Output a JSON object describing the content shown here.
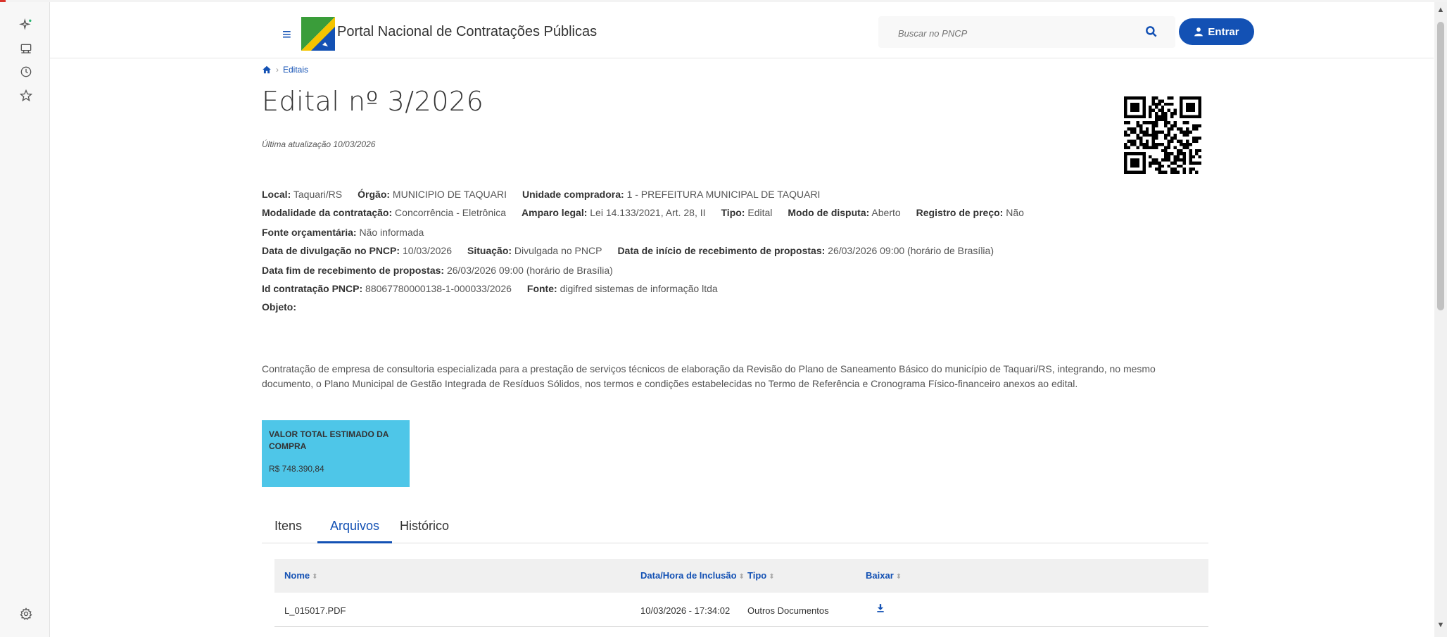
{
  "header": {
    "portal_title": "Portal Nacional de Contratações Públicas",
    "search_placeholder": "Buscar no PNCP",
    "login_label": "Entrar"
  },
  "breadcrumb": {
    "current": "Editais"
  },
  "edital": {
    "title": "Edital nº 3/2026",
    "updated": "Última atualização 10/03/2026",
    "rows": [
      [
        {
          "label": "Local:",
          "value": "Taquari/RS"
        },
        {
          "label": "Órgão:",
          "value": "MUNICIPIO DE TAQUARI"
        },
        {
          "label": "Unidade compradora:",
          "value": "1 - PREFEITURA MUNICIPAL DE TAQUARI"
        }
      ],
      [
        {
          "label": "Modalidade da contratação:",
          "value": "Concorrência - Eletrônica"
        },
        {
          "label": "Amparo legal:",
          "value": "Lei 14.133/2021, Art. 28, II"
        },
        {
          "label": "Tipo:",
          "value": "Edital"
        },
        {
          "label": "Modo de disputa:",
          "value": "Aberto"
        },
        {
          "label": "Registro de preço:",
          "value": "Não"
        }
      ],
      [
        {
          "label": "Fonte orçamentária:",
          "value": "Não informada"
        }
      ],
      [
        {
          "label": "Data de divulgação no PNCP:",
          "value": "10/03/2026"
        },
        {
          "label": "Situação:",
          "value": "Divulgada no PNCP"
        },
        {
          "label": "Data de início de recebimento de propostas:",
          "value": "26/03/2026 09:00 (horário de Brasília)"
        }
      ],
      [
        {
          "label": "Data fim de recebimento de propostas:",
          "value": "26/03/2026 09:00 (horário de Brasília)"
        }
      ],
      [
        {
          "label": "Id contratação PNCP:",
          "value": "88067780000138-1-000033/2026"
        },
        {
          "label": "Fonte:",
          "value": "digifred sistemas de informação ltda"
        }
      ],
      [
        {
          "label": "Objeto:",
          "value": ""
        }
      ]
    ],
    "objeto": "Contratação de empresa de consultoria especializada para a prestação de serviços técnicos de elaboração da Revisão do Plano de Saneamento Básico do município de Taquari/RS, integrando, no mesmo documento, o Plano Municipal de Gestão Integrada de Resíduos Sólidos, nos termos e condições estabelecidas no Termo de Referência e Cronograma Físico-financeiro anexos ao edital.",
    "value_card": {
      "label": "VALOR TOTAL ESTIMADO DA COMPRA",
      "amount": "R$ 748.390,84"
    }
  },
  "tabs": [
    "Itens",
    "Arquivos",
    "Histórico"
  ],
  "active_tab": "Arquivos",
  "table": {
    "headers": [
      "Nome",
      "Data/Hora de Inclusão",
      "Tipo",
      "Baixar"
    ],
    "sort_glyph": "⬍",
    "rows": [
      {
        "nome": "L_015017.PDF",
        "data": "10/03/2026 - 17:34:02",
        "tipo": "Outros Documentos"
      }
    ]
  },
  "colors": {
    "primary": "#1351b4",
    "value_card": "#4ec6e8"
  },
  "icons": {
    "sidebar": [
      "sparkle-icon",
      "briefcase-icon",
      "clock-icon",
      "star-icon",
      "gear-icon"
    ],
    "search": "search-icon",
    "login": "user-icon",
    "breadcrumb_home": "home-icon",
    "download": "download-icon"
  }
}
